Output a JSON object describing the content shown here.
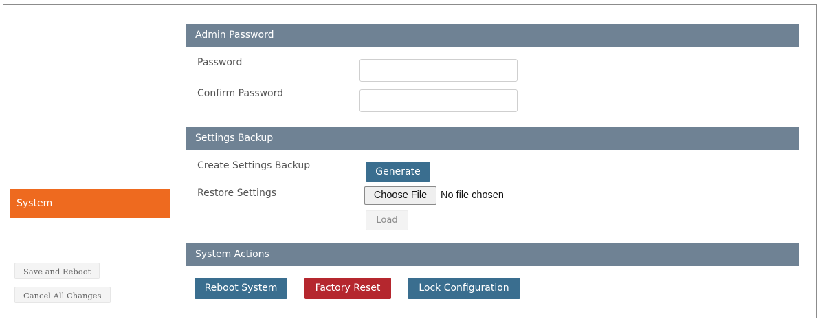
{
  "sidebar": {
    "active_item": "System",
    "save_reboot_label": "Save and Reboot",
    "cancel_changes_label": "Cancel All Changes"
  },
  "admin_password": {
    "title": "Admin Password",
    "password_label": "Password",
    "password_value": "",
    "confirm_label": "Confirm Password",
    "confirm_value": ""
  },
  "settings_backup": {
    "title": "Settings Backup",
    "create_label": "Create Settings Backup",
    "generate_button": "Generate",
    "restore_label": "Restore Settings",
    "choose_file_button": "Choose File",
    "file_status": "No file chosen",
    "load_button": "Load"
  },
  "system_actions": {
    "title": "System Actions",
    "reboot_button": "Reboot System",
    "factory_reset_button": "Factory Reset",
    "lock_button": "Lock Configuration"
  },
  "colors": {
    "active_nav": "#ee6a1f",
    "section_header": "#6f8294",
    "primary_button": "#3a6e8f",
    "danger_button": "#b5272e"
  }
}
